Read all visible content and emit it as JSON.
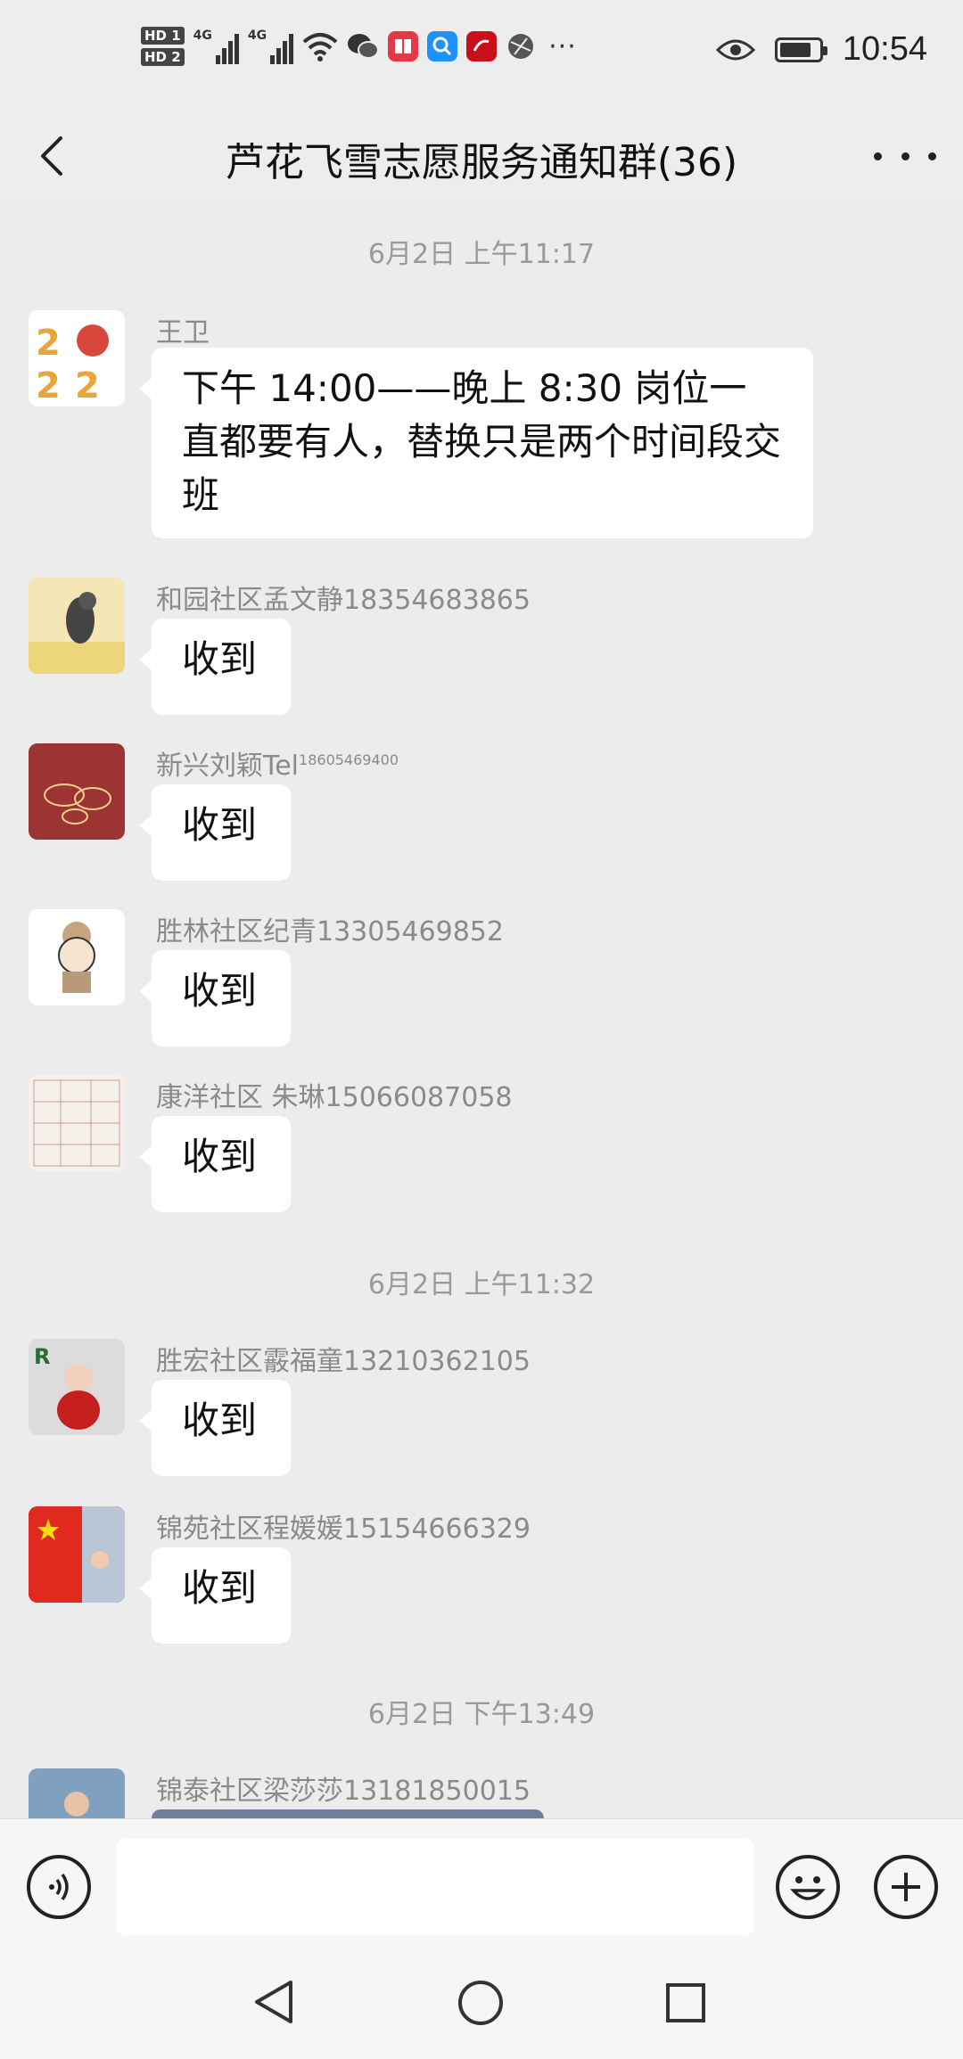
{
  "status_bar": {
    "hd1": "HD 1",
    "hd2": "HD 2",
    "signal1": "4G",
    "signal2": "4G",
    "more": "···",
    "time": "10:54",
    "battery_level": 0.8,
    "icons": [
      "wifi-icon",
      "wechat-icon",
      "book-app-icon",
      "search-app-icon",
      "red-app-icon",
      "globe-icon",
      "eye-icon",
      "battery-icon"
    ]
  },
  "header": {
    "back_icon": "chevron-left-icon",
    "title": "芦花飞雪志愿服务通知群(36)",
    "more_icon": "more-dots-icon"
  },
  "chat": {
    "timestamps": [
      "6月2日 上午11:17",
      "6月2日 上午11:32",
      "6月2日 下午13:49"
    ],
    "messages": [
      {
        "sender": "王卫",
        "text": "下午 14:00——晚上 8:30 岗位一直都要有人，替换只是两个时间段交班"
      },
      {
        "sender": "和园社区孟文静18354683865",
        "text": "收到"
      },
      {
        "sender": "新兴刘颖Tel",
        "sender_sup": "18605469400",
        "text": "收到"
      },
      {
        "sender": "胜林社区纪青13305469852",
        "text": "收到"
      },
      {
        "sender": "康洋社区  朱琳15066087058",
        "text": "收到"
      },
      {
        "sender": "胜宏社区霰福童13210362105",
        "text": "收到"
      },
      {
        "sender": "锦苑社区程媛媛15154666329",
        "text": "收到"
      },
      {
        "sender": "锦泰社区梁莎莎13181850015",
        "text": ""
      }
    ]
  },
  "input_bar": {
    "voice_icon": "voice-icon",
    "emoji_icon": "emoji-icon",
    "plus_icon": "plus-icon",
    "placeholder": ""
  },
  "nav": {
    "back": "nav-back-icon",
    "home": "nav-home-icon",
    "recents": "nav-recents-icon"
  }
}
